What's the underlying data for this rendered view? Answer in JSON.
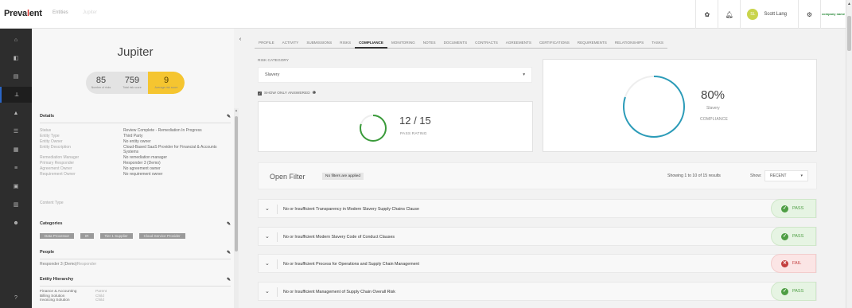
{
  "header": {
    "logo_pre": "Preva",
    "logo_dot": "l",
    "logo_post": "ent",
    "crumb_entities": "Entities",
    "crumb_jupiter": "Jupiter",
    "user_initials": "SL",
    "user_name": "Scott Lang",
    "partner_logo": "company name",
    "icons": [
      "gear-icon",
      "bell-icon",
      "settings-icon"
    ]
  },
  "nav": {
    "icons": [
      "home-icon",
      "dashboard-icon",
      "document-icon",
      "hierarchy-icon",
      "warning-icon",
      "list-icon",
      "calendar-icon",
      "table-icon",
      "grid-icon",
      "chart-icon",
      "users-icon",
      "help-icon"
    ],
    "active": "hierarchy-icon"
  },
  "entity": {
    "name": "Jupiter",
    "scores": [
      {
        "value": "85",
        "label": "Number of risks"
      },
      {
        "value": "759",
        "label": "Total risk score"
      },
      {
        "value": "9",
        "label": "Average risk score"
      }
    ],
    "details_title": "Details",
    "details": [
      {
        "key": "Status",
        "value": "Review Complete - Remediation In Progress"
      },
      {
        "key": "Entity Type",
        "value": "Third Party"
      },
      {
        "key": "Entity Owner",
        "value": "No entity owner"
      },
      {
        "key": "Entity Description",
        "value": "Cloud-Based SaaS Provider for Financial & Accounts Systems"
      },
      {
        "key": "Remediation Manager",
        "value": "No remediation manager"
      },
      {
        "key": "Primary Responder",
        "value": "Responder 3 (Demo)"
      },
      {
        "key": "Agreement Owner",
        "value": "No agreement owner"
      },
      {
        "key": "Requirement Owner",
        "value": "No requirement owner"
      }
    ],
    "content_type": "Content Type",
    "categories_title": "Categories",
    "categories": [
      "Data Processor",
      "IR",
      "Tier 1 Supplier",
      "Cloud Service Provider"
    ],
    "people_title": "People",
    "people_name": "Responder 3 (Demo)",
    "people_role": "Responder",
    "hierarchy_title": "Entity Hierarchy",
    "hierarchy": [
      {
        "name": "Finance & Accounting",
        "rel": "Parent"
      },
      {
        "name": "Billing Solution",
        "rel": "Child"
      },
      {
        "name": "Invoicing Solution",
        "rel": "Child"
      }
    ]
  },
  "tabs": [
    "PROFILE",
    "ACTIVITY",
    "SUBMISSIONS",
    "RISKS",
    "COMPLIANCE",
    "MONITORING",
    "NOTES",
    "DOCUMENTS",
    "CONTRACTS",
    "AGREEMENTS",
    "CERTIFICATIONS",
    "REQUIREMENTS",
    "RELATIONSHIPS",
    "TASKS"
  ],
  "active_tab": "COMPLIANCE",
  "compliance": {
    "risk_category_label": "RISK CATEGORY",
    "risk_category_value": "Slavery",
    "show_only_answered": "SHOW ONLY ANSWERED",
    "pass_rating_value": "12 / 15",
    "pass_rating_label": "PASS RATING",
    "pass_fraction": 0.8,
    "compliance_pct": "80%",
    "compliance_category": "Slavery",
    "compliance_label": "COMPLIANCE",
    "compliance_fraction": 0.8,
    "ring_color": "#2a9bb8",
    "pass_ring_color": "#3a9b3a"
  },
  "filter": {
    "title": "Open Filter",
    "badge": "No filters are applied",
    "showing": "Showing 1 to 10 of 15 results",
    "show_label": "Show:",
    "show_value": "RECENT"
  },
  "results": [
    {
      "title": "No or Insufficient Transparency in Modern Slavery Supply Chains Clause",
      "status": "PASS"
    },
    {
      "title": "No or Insufficient Modern Slavery Code of Conduct Clauses",
      "status": "PASS"
    },
    {
      "title": "No or Insufficient Process for Operations and Supply Chain Management",
      "status": "FAIL"
    },
    {
      "title": "No or Insufficient Management of Supply Chain Overall Risk",
      "status": "PASS"
    }
  ]
}
